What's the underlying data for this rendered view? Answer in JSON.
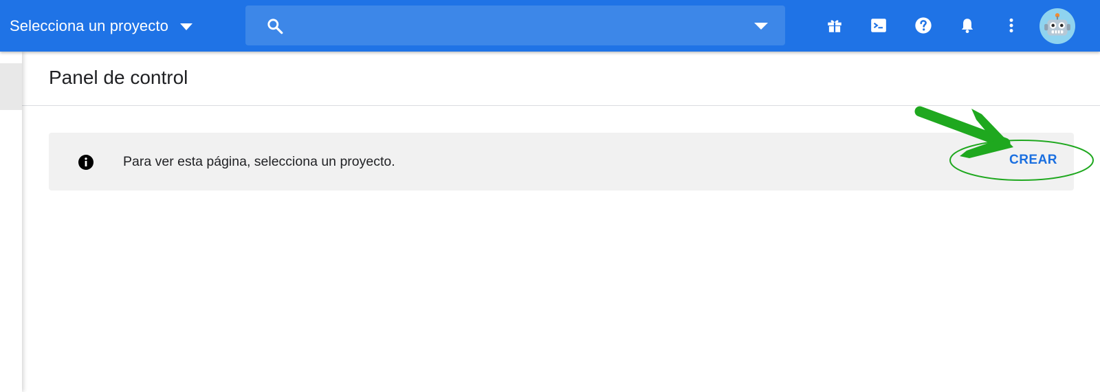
{
  "topbar": {
    "project_picker_label": "Selecciona un proyecto",
    "search_placeholder": "",
    "icons": [
      "gift-icon",
      "terminal-icon",
      "help-icon",
      "notifications-icon",
      "more-vert-icon"
    ],
    "avatar_icon": "robot-avatar-icon"
  },
  "page": {
    "title": "Panel de control"
  },
  "notice": {
    "icon": "info-icon",
    "message": "Para ver esta página, selecciona un proyecto.",
    "create_label": "CREAR"
  },
  "colors": {
    "topbar": "#1f73e6",
    "search_box": "#3d87e8",
    "accent": "#1a6fe0",
    "annotation": "#1fa81f"
  }
}
